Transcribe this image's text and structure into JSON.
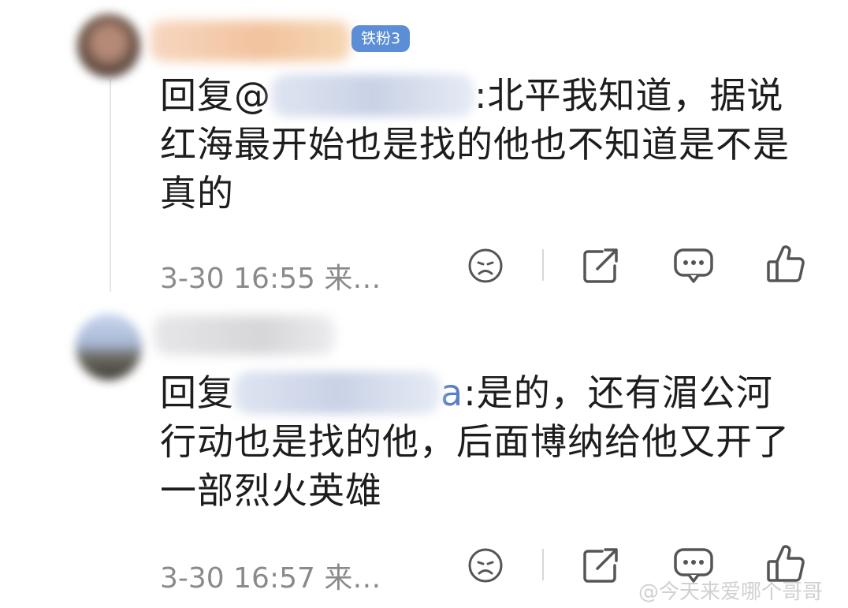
{
  "comments": [
    {
      "badge": "铁粉3",
      "reply_prefix": "回复@",
      "mention_tail": "",
      "text_after_mention": ":北平我知道，据说红海最开始也是找的他也不知道是不是真的",
      "meta": "3-30 16:55 来…"
    },
    {
      "reply_prefix": "回复",
      "mention_tail": "a",
      "text_after_mention": ":是的，还有湄公河行动也是找的他，后面博纳给他又开了一部烈火英雄",
      "meta": "3-30 16:57 来…"
    }
  ],
  "icons": [
    "sad-face-icon",
    "share-icon",
    "comment-icon",
    "like-icon"
  ],
  "watermark": "@今天来爱哪个哥哥",
  "colors": {
    "badge": "#5b8ed6",
    "mention": "#5b7fc4",
    "meta": "#8a8a8a"
  }
}
